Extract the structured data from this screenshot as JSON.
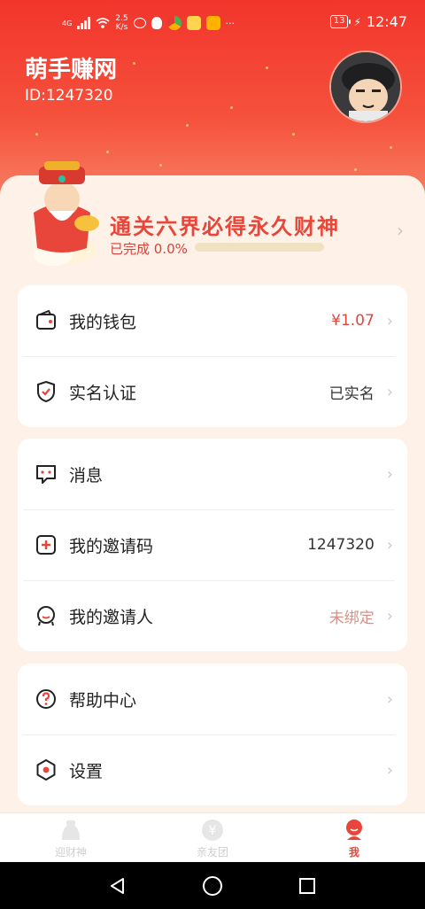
{
  "status_bar": {
    "network": "4G",
    "speed": "2.5\nK/s",
    "battery": "13",
    "time": "12:47"
  },
  "header": {
    "app_name": "萌手赚网",
    "user_id": "ID:1247320"
  },
  "promo": {
    "title": "通关六界必得永久财神",
    "progress_label": "已完成 0.0%",
    "progress": 0.0
  },
  "card_account": [
    {
      "icon": "wallet-icon",
      "label": "我的钱包",
      "value": "¥1.07"
    },
    {
      "icon": "shield-check-icon",
      "label": "实名认证",
      "value": "已实名"
    }
  ],
  "card_social": [
    {
      "icon": "message-icon",
      "label": "消息",
      "value": ""
    },
    {
      "icon": "invite-code-icon",
      "label": "我的邀请码",
      "value": "1247320"
    },
    {
      "icon": "inviter-icon",
      "label": "我的邀请人",
      "value": "未绑定"
    }
  ],
  "card_misc": [
    {
      "icon": "help-icon",
      "label": "帮助中心",
      "value": ""
    },
    {
      "icon": "settings-icon",
      "label": "设置",
      "value": ""
    }
  ],
  "tabbar": {
    "tabs": [
      {
        "label": "迎财神",
        "icon": "fortune-god-icon",
        "active": false
      },
      {
        "label": "亲友团",
        "icon": "coin-icon",
        "active": false
      },
      {
        "label": "我",
        "icon": "profile-icon",
        "active": true
      }
    ]
  },
  "colors": {
    "brand_red": "#e8463a",
    "header_gradient_top": "#f2352c",
    "page_bg": "#fdf1e8"
  }
}
